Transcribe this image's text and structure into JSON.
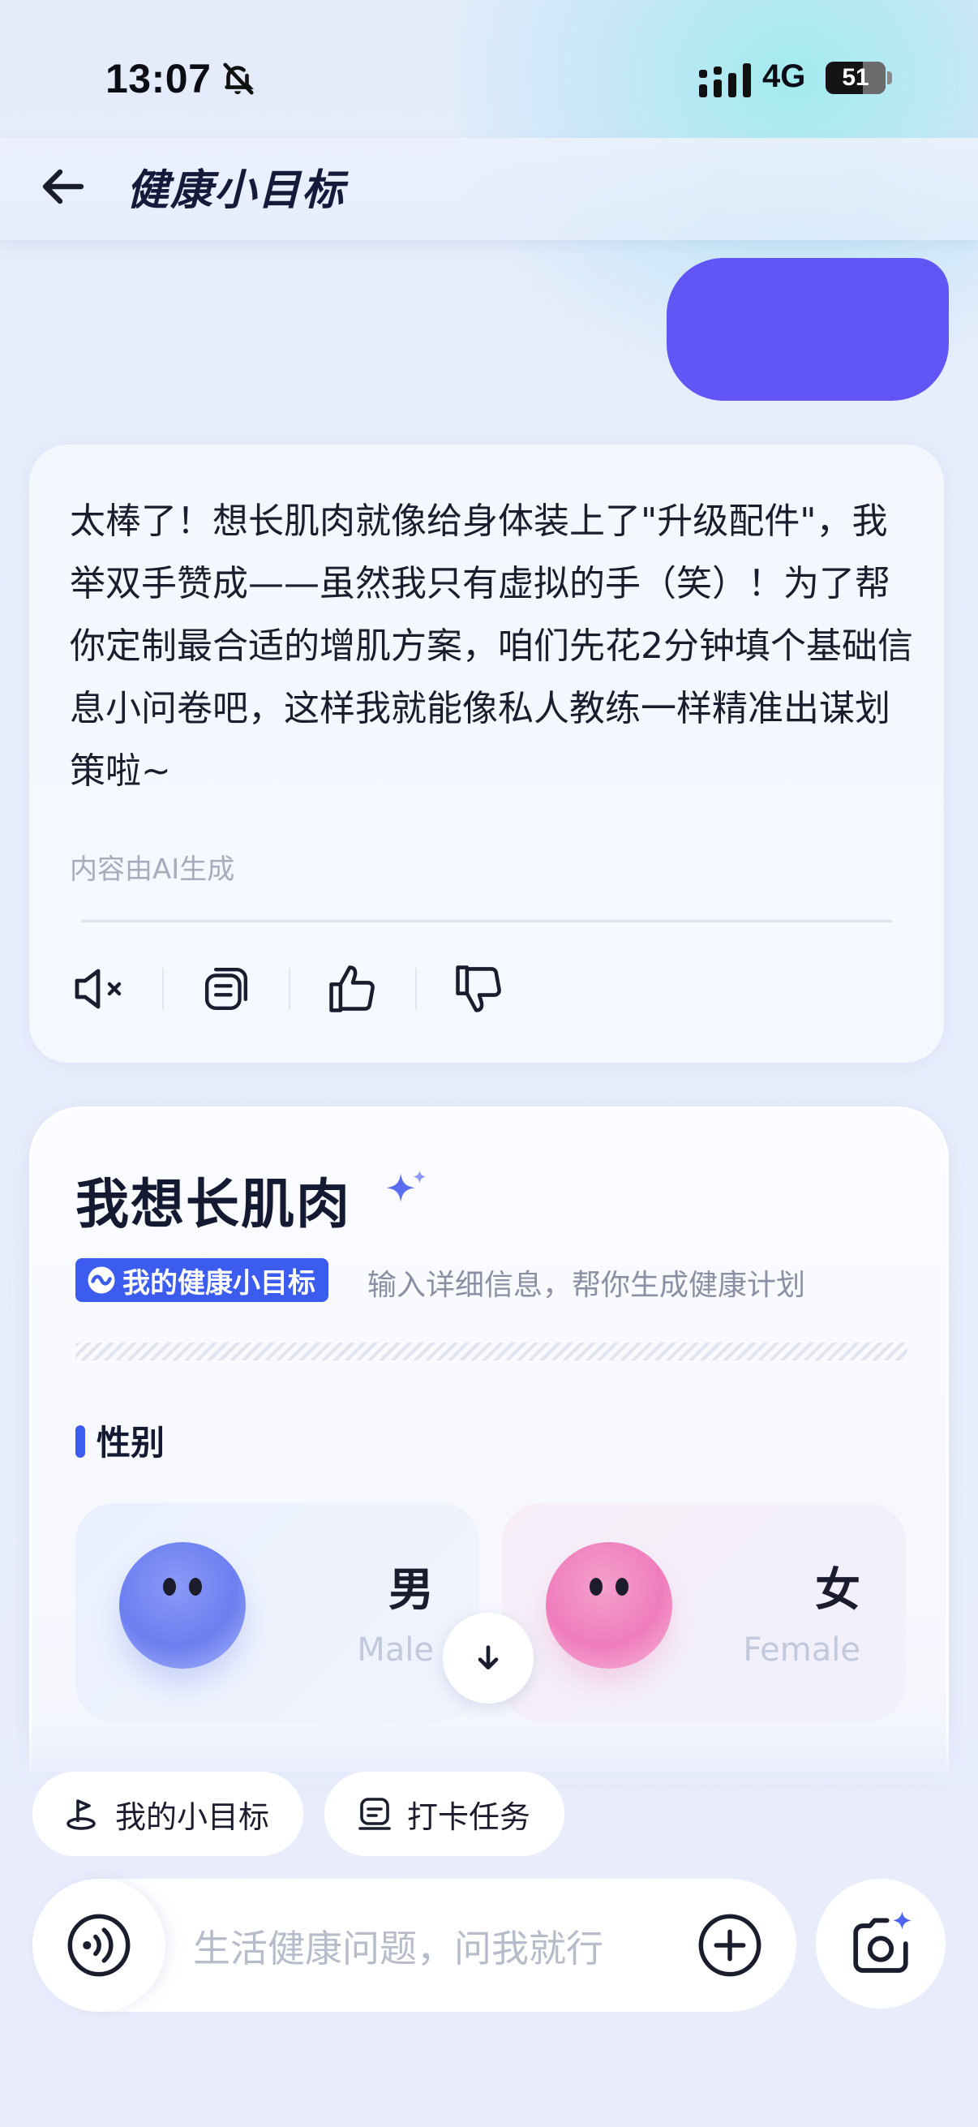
{
  "status_bar": {
    "time": "13:07",
    "network": "4G",
    "battery": "51"
  },
  "nav": {
    "title": "健康小目标"
  },
  "ai_message": {
    "text": "太棒了！想长肌肉就像给身体装上了\"升级配件\"，我举双手赞成——虽然我只有虚拟的手（笑）！为了帮你定制最合适的增肌方案，咱们先花2分钟填个基础信息小问卷吧，这样我就能像私人教练一样精准出谋划策啦~",
    "note": "内容由AI生成"
  },
  "form": {
    "title": "我想长肌肉",
    "tag": "我的健康小目标",
    "subtitle": "输入详细信息，帮你生成健康计划",
    "section_label": "性别",
    "options": [
      {
        "cn": "男",
        "en": "Male"
      },
      {
        "cn": "女",
        "en": "Female"
      }
    ]
  },
  "chips": [
    {
      "label": "我的小目标"
    },
    {
      "label": "打卡任务"
    }
  ],
  "input": {
    "placeholder": "生活健康问题，问我就行"
  },
  "colors": {
    "accent": "#3c5cf0",
    "user_bubble": "#6155f5"
  }
}
